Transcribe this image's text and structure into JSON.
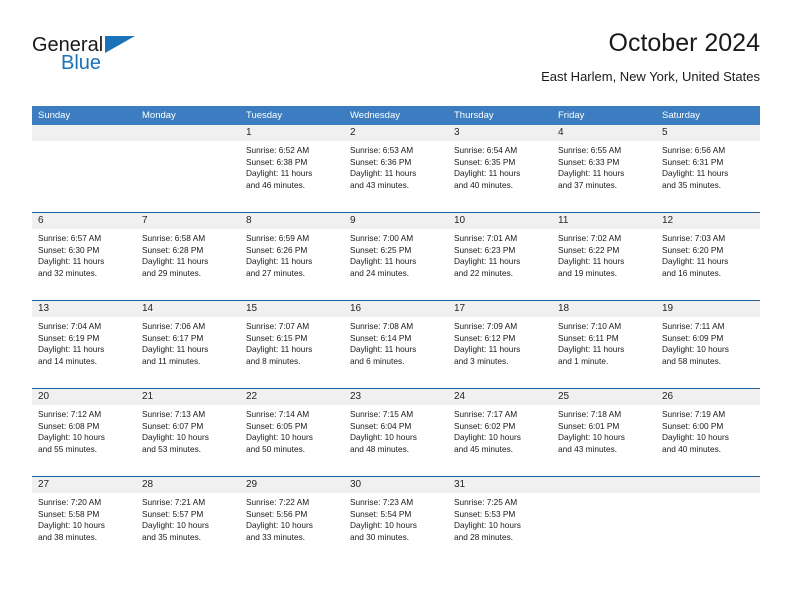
{
  "brand": {
    "name_part1": "General",
    "name_part2": "Blue",
    "accent_color": "#1b72b8"
  },
  "header": {
    "title": "October 2024",
    "subtitle": "East Harlem, New York, United States"
  },
  "theme": {
    "header_bar_color": "#3b7dc0",
    "row_divider_color": "#1f5fa0",
    "daynum_band_color": "#f0f0f0",
    "text_color": "#1a1a1a"
  },
  "weekdays": [
    "Sunday",
    "Monday",
    "Tuesday",
    "Wednesday",
    "Thursday",
    "Friday",
    "Saturday"
  ],
  "weeks": [
    [
      {
        "day": "",
        "empty": true,
        "sunrise": "",
        "sunset": "",
        "daylight1": "",
        "daylight2": ""
      },
      {
        "day": "",
        "empty": true,
        "sunrise": "",
        "sunset": "",
        "daylight1": "",
        "daylight2": ""
      },
      {
        "day": "1",
        "sunrise": "Sunrise: 6:52 AM",
        "sunset": "Sunset: 6:38 PM",
        "daylight1": "Daylight: 11 hours",
        "daylight2": "and 46 minutes."
      },
      {
        "day": "2",
        "sunrise": "Sunrise: 6:53 AM",
        "sunset": "Sunset: 6:36 PM",
        "daylight1": "Daylight: 11 hours",
        "daylight2": "and 43 minutes."
      },
      {
        "day": "3",
        "sunrise": "Sunrise: 6:54 AM",
        "sunset": "Sunset: 6:35 PM",
        "daylight1": "Daylight: 11 hours",
        "daylight2": "and 40 minutes."
      },
      {
        "day": "4",
        "sunrise": "Sunrise: 6:55 AM",
        "sunset": "Sunset: 6:33 PM",
        "daylight1": "Daylight: 11 hours",
        "daylight2": "and 37 minutes."
      },
      {
        "day": "5",
        "sunrise": "Sunrise: 6:56 AM",
        "sunset": "Sunset: 6:31 PM",
        "daylight1": "Daylight: 11 hours",
        "daylight2": "and 35 minutes."
      }
    ],
    [
      {
        "day": "6",
        "sunrise": "Sunrise: 6:57 AM",
        "sunset": "Sunset: 6:30 PM",
        "daylight1": "Daylight: 11 hours",
        "daylight2": "and 32 minutes."
      },
      {
        "day": "7",
        "sunrise": "Sunrise: 6:58 AM",
        "sunset": "Sunset: 6:28 PM",
        "daylight1": "Daylight: 11 hours",
        "daylight2": "and 29 minutes."
      },
      {
        "day": "8",
        "sunrise": "Sunrise: 6:59 AM",
        "sunset": "Sunset: 6:26 PM",
        "daylight1": "Daylight: 11 hours",
        "daylight2": "and 27 minutes."
      },
      {
        "day": "9",
        "sunrise": "Sunrise: 7:00 AM",
        "sunset": "Sunset: 6:25 PM",
        "daylight1": "Daylight: 11 hours",
        "daylight2": "and 24 minutes."
      },
      {
        "day": "10",
        "sunrise": "Sunrise: 7:01 AM",
        "sunset": "Sunset: 6:23 PM",
        "daylight1": "Daylight: 11 hours",
        "daylight2": "and 22 minutes."
      },
      {
        "day": "11",
        "sunrise": "Sunrise: 7:02 AM",
        "sunset": "Sunset: 6:22 PM",
        "daylight1": "Daylight: 11 hours",
        "daylight2": "and 19 minutes."
      },
      {
        "day": "12",
        "sunrise": "Sunrise: 7:03 AM",
        "sunset": "Sunset: 6:20 PM",
        "daylight1": "Daylight: 11 hours",
        "daylight2": "and 16 minutes."
      }
    ],
    [
      {
        "day": "13",
        "sunrise": "Sunrise: 7:04 AM",
        "sunset": "Sunset: 6:19 PM",
        "daylight1": "Daylight: 11 hours",
        "daylight2": "and 14 minutes."
      },
      {
        "day": "14",
        "sunrise": "Sunrise: 7:06 AM",
        "sunset": "Sunset: 6:17 PM",
        "daylight1": "Daylight: 11 hours",
        "daylight2": "and 11 minutes."
      },
      {
        "day": "15",
        "sunrise": "Sunrise: 7:07 AM",
        "sunset": "Sunset: 6:15 PM",
        "daylight1": "Daylight: 11 hours",
        "daylight2": "and 8 minutes."
      },
      {
        "day": "16",
        "sunrise": "Sunrise: 7:08 AM",
        "sunset": "Sunset: 6:14 PM",
        "daylight1": "Daylight: 11 hours",
        "daylight2": "and 6 minutes."
      },
      {
        "day": "17",
        "sunrise": "Sunrise: 7:09 AM",
        "sunset": "Sunset: 6:12 PM",
        "daylight1": "Daylight: 11 hours",
        "daylight2": "and 3 minutes."
      },
      {
        "day": "18",
        "sunrise": "Sunrise: 7:10 AM",
        "sunset": "Sunset: 6:11 PM",
        "daylight1": "Daylight: 11 hours",
        "daylight2": "and 1 minute."
      },
      {
        "day": "19",
        "sunrise": "Sunrise: 7:11 AM",
        "sunset": "Sunset: 6:09 PM",
        "daylight1": "Daylight: 10 hours",
        "daylight2": "and 58 minutes."
      }
    ],
    [
      {
        "day": "20",
        "sunrise": "Sunrise: 7:12 AM",
        "sunset": "Sunset: 6:08 PM",
        "daylight1": "Daylight: 10 hours",
        "daylight2": "and 55 minutes."
      },
      {
        "day": "21",
        "sunrise": "Sunrise: 7:13 AM",
        "sunset": "Sunset: 6:07 PM",
        "daylight1": "Daylight: 10 hours",
        "daylight2": "and 53 minutes."
      },
      {
        "day": "22",
        "sunrise": "Sunrise: 7:14 AM",
        "sunset": "Sunset: 6:05 PM",
        "daylight1": "Daylight: 10 hours",
        "daylight2": "and 50 minutes."
      },
      {
        "day": "23",
        "sunrise": "Sunrise: 7:15 AM",
        "sunset": "Sunset: 6:04 PM",
        "daylight1": "Daylight: 10 hours",
        "daylight2": "and 48 minutes."
      },
      {
        "day": "24",
        "sunrise": "Sunrise: 7:17 AM",
        "sunset": "Sunset: 6:02 PM",
        "daylight1": "Daylight: 10 hours",
        "daylight2": "and 45 minutes."
      },
      {
        "day": "25",
        "sunrise": "Sunrise: 7:18 AM",
        "sunset": "Sunset: 6:01 PM",
        "daylight1": "Daylight: 10 hours",
        "daylight2": "and 43 minutes."
      },
      {
        "day": "26",
        "sunrise": "Sunrise: 7:19 AM",
        "sunset": "Sunset: 6:00 PM",
        "daylight1": "Daylight: 10 hours",
        "daylight2": "and 40 minutes."
      }
    ],
    [
      {
        "day": "27",
        "sunrise": "Sunrise: 7:20 AM",
        "sunset": "Sunset: 5:58 PM",
        "daylight1": "Daylight: 10 hours",
        "daylight2": "and 38 minutes."
      },
      {
        "day": "28",
        "sunrise": "Sunrise: 7:21 AM",
        "sunset": "Sunset: 5:57 PM",
        "daylight1": "Daylight: 10 hours",
        "daylight2": "and 35 minutes."
      },
      {
        "day": "29",
        "sunrise": "Sunrise: 7:22 AM",
        "sunset": "Sunset: 5:56 PM",
        "daylight1": "Daylight: 10 hours",
        "daylight2": "and 33 minutes."
      },
      {
        "day": "30",
        "sunrise": "Sunrise: 7:23 AM",
        "sunset": "Sunset: 5:54 PM",
        "daylight1": "Daylight: 10 hours",
        "daylight2": "and 30 minutes."
      },
      {
        "day": "31",
        "sunrise": "Sunrise: 7:25 AM",
        "sunset": "Sunset: 5:53 PM",
        "daylight1": "Daylight: 10 hours",
        "daylight2": "and 28 minutes."
      },
      {
        "day": "",
        "empty": true,
        "sunrise": "",
        "sunset": "",
        "daylight1": "",
        "daylight2": ""
      },
      {
        "day": "",
        "empty": true,
        "sunrise": "",
        "sunset": "",
        "daylight1": "",
        "daylight2": ""
      }
    ]
  ]
}
